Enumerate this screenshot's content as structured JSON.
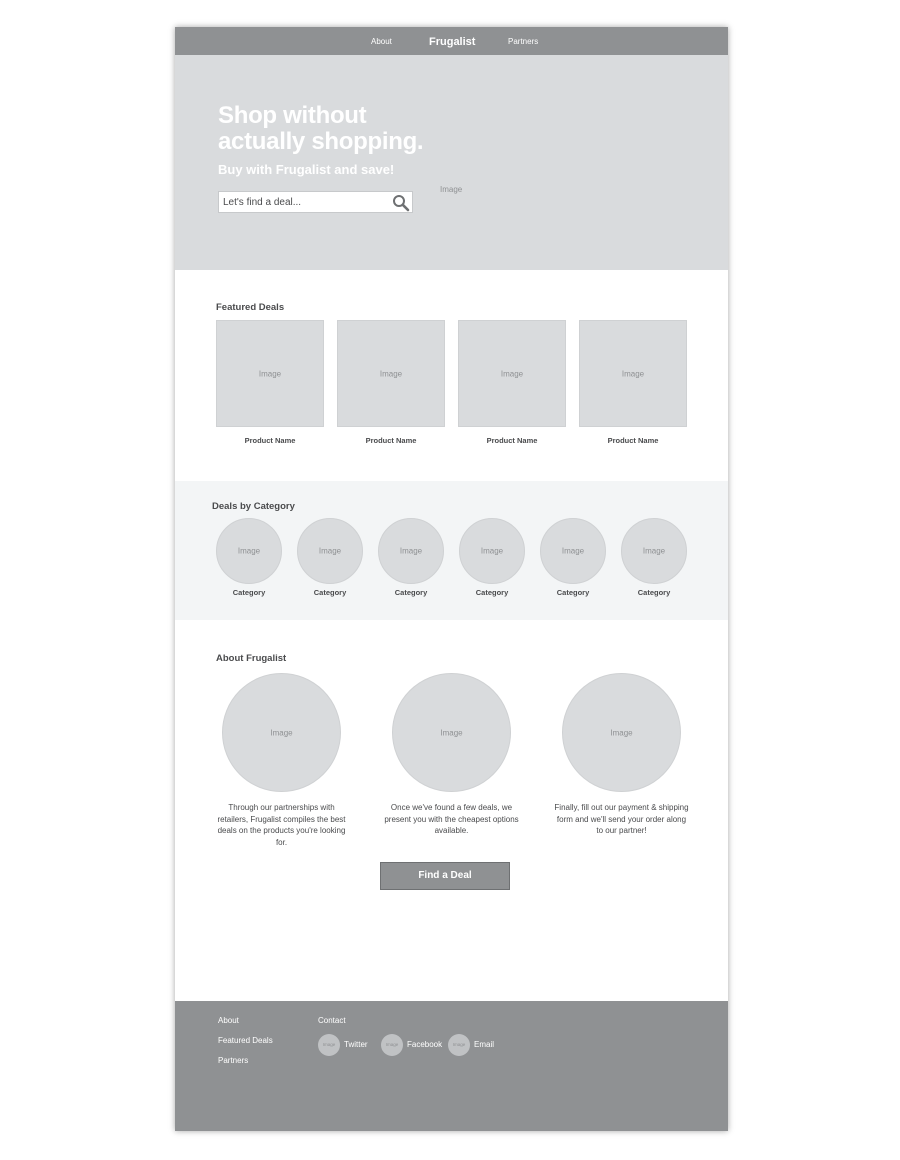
{
  "nav": {
    "about": "About",
    "brand": "Frugalist",
    "partners": "Partners"
  },
  "hero": {
    "title_line1": "Shop without",
    "title_line2": "actually shopping.",
    "subtitle": "Buy with Frugalist and save!",
    "image_label": "Image",
    "search_placeholder": "Let's find a deal..."
  },
  "featured": {
    "title": "Featured Deals",
    "products": [
      {
        "image_label": "Image",
        "name": "Product Name"
      },
      {
        "image_label": "Image",
        "name": "Product Name"
      },
      {
        "image_label": "Image",
        "name": "Product Name"
      },
      {
        "image_label": "Image",
        "name": "Product Name"
      }
    ]
  },
  "categories": {
    "title": "Deals by Category",
    "items": [
      {
        "image_label": "Image",
        "name": "Category"
      },
      {
        "image_label": "Image",
        "name": "Category"
      },
      {
        "image_label": "Image",
        "name": "Category"
      },
      {
        "image_label": "Image",
        "name": "Category"
      },
      {
        "image_label": "Image",
        "name": "Category"
      },
      {
        "image_label": "Image",
        "name": "Category"
      }
    ]
  },
  "about": {
    "title": "About Frugalist",
    "items": [
      {
        "image_label": "Image",
        "text": "Through our partnerships with retailers, Frugalist compiles the best deals on the products you're looking for."
      },
      {
        "image_label": "Image",
        "text": "Once we've found a few deals, we present you with the cheapest options available."
      },
      {
        "image_label": "Image",
        "text": "Finally, fill out our payment & shipping form and we'll send your order along to our partner!"
      }
    ],
    "cta_label": "Find a Deal"
  },
  "footer": {
    "links": [
      "About",
      "Featured Deals",
      "Partners"
    ],
    "contact_title": "Contact",
    "socials": [
      {
        "icon_label": "Image",
        "label": "Twitter"
      },
      {
        "icon_label": "Image",
        "label": "Facebook"
      },
      {
        "icon_label": "Image",
        "label": "Email"
      }
    ]
  }
}
